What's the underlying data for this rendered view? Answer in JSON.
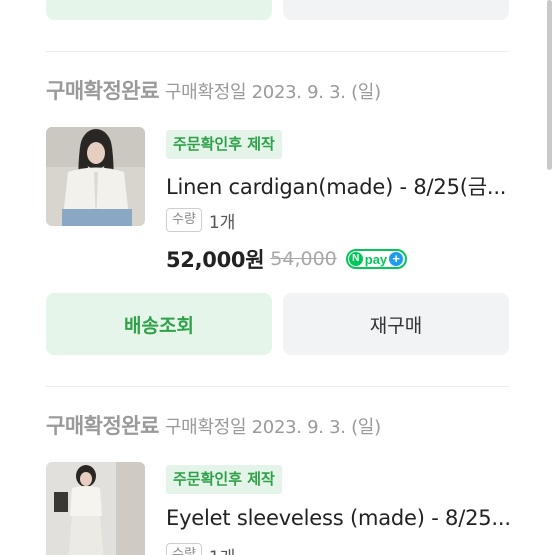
{
  "orders": [
    {
      "status": "구매확정완료",
      "status_date": "구매확정일 2023. 9. 3. (일)",
      "badge": "주문확인후 제작",
      "product_title": "Linen cardigan(made) - 8/25(금...",
      "qty_label": "수량",
      "qty_value": "1개",
      "price": "52,000원",
      "original_price": "54,000",
      "npay_n": "N",
      "npay_text": "pay",
      "npay_plus": "+",
      "track_label": "배송조회",
      "rebuy_label": "재구매"
    },
    {
      "status": "구매확정완료",
      "status_date": "구매확정일 2023. 9. 3. (일)",
      "badge": "주문확인후 제작",
      "product_title": "Eyelet sleeveless (made) - 8/25...",
      "qty_label": "수량",
      "qty_value": "1개"
    }
  ],
  "colors": {
    "accent_green": "#2fa14a",
    "green_bg": "#e6f5ea",
    "gray_bg": "#f2f3f5",
    "npay_green": "#03c75a",
    "npay_blue": "#1e9cf0"
  },
  "icons": [
    "npay-logo-icon",
    "product-thumbnail-image"
  ]
}
